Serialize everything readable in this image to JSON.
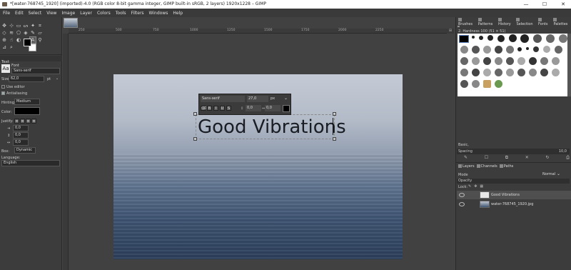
{
  "window": {
    "title": "*[water-768745_1920] (imported)-4.0 (RGB color 8-bit gamma integer, GIMP built-in sRGB, 2 layers) 1920x1228 – GIMP",
    "minimize": "—",
    "maximize": "☐",
    "close": "✕"
  },
  "menu": [
    "File",
    "Edit",
    "Select",
    "View",
    "Image",
    "Layer",
    "Colors",
    "Tools",
    "Filters",
    "Windows",
    "Help"
  ],
  "tool_options": {
    "section": "Text",
    "font_label": "Font",
    "font_value": "Sans-serif",
    "size_label": "Size:",
    "size_value": "62,0",
    "size_unit": "pt",
    "use_editor": "Use editor",
    "antialiasing": "Antialiasing",
    "hinting_label": "Hinting:",
    "hinting_value": "Medium",
    "color_label": "Color:",
    "justify_label": "Justify:",
    "indent_value": "0,0",
    "line_spacing_value": "0,0",
    "letter_spacing_value": "0,0",
    "box_label": "Box:",
    "box_value": "Dynamic",
    "language_label": "Language:",
    "language_value": "English"
  },
  "ruler": {
    "top": [
      "250",
      "500",
      "750",
      "1000",
      "1250",
      "1500",
      "1750",
      "2000",
      "2250"
    ]
  },
  "style_editor": {
    "font": "Sans-serif",
    "size": "27,0",
    "unit": "px",
    "baseline": "0,0",
    "kerning": "0,0"
  },
  "canvas": {
    "text": "Good Vibrations"
  },
  "brushes_dock": {
    "tabs": [
      "Brushes",
      "Patterns",
      "History",
      "Selection",
      "Fonts",
      "Palettes"
    ],
    "brush_name": "2. Hardness 100 (51 × 51)",
    "tag_value": "Basic,",
    "spacing_label": "Spacing",
    "spacing_value": "10,0"
  },
  "layers_dock": {
    "tabs": [
      "Layers",
      "Channels",
      "Paths"
    ],
    "mode_label": "Mode",
    "mode_value": "Normal",
    "opacity_label": "Opacity",
    "lock_label": "Lock:",
    "layers": [
      {
        "name": "Good Vibrations",
        "selected": true
      },
      {
        "name": "water-768745_1920.jpg",
        "selected": false
      }
    ]
  }
}
